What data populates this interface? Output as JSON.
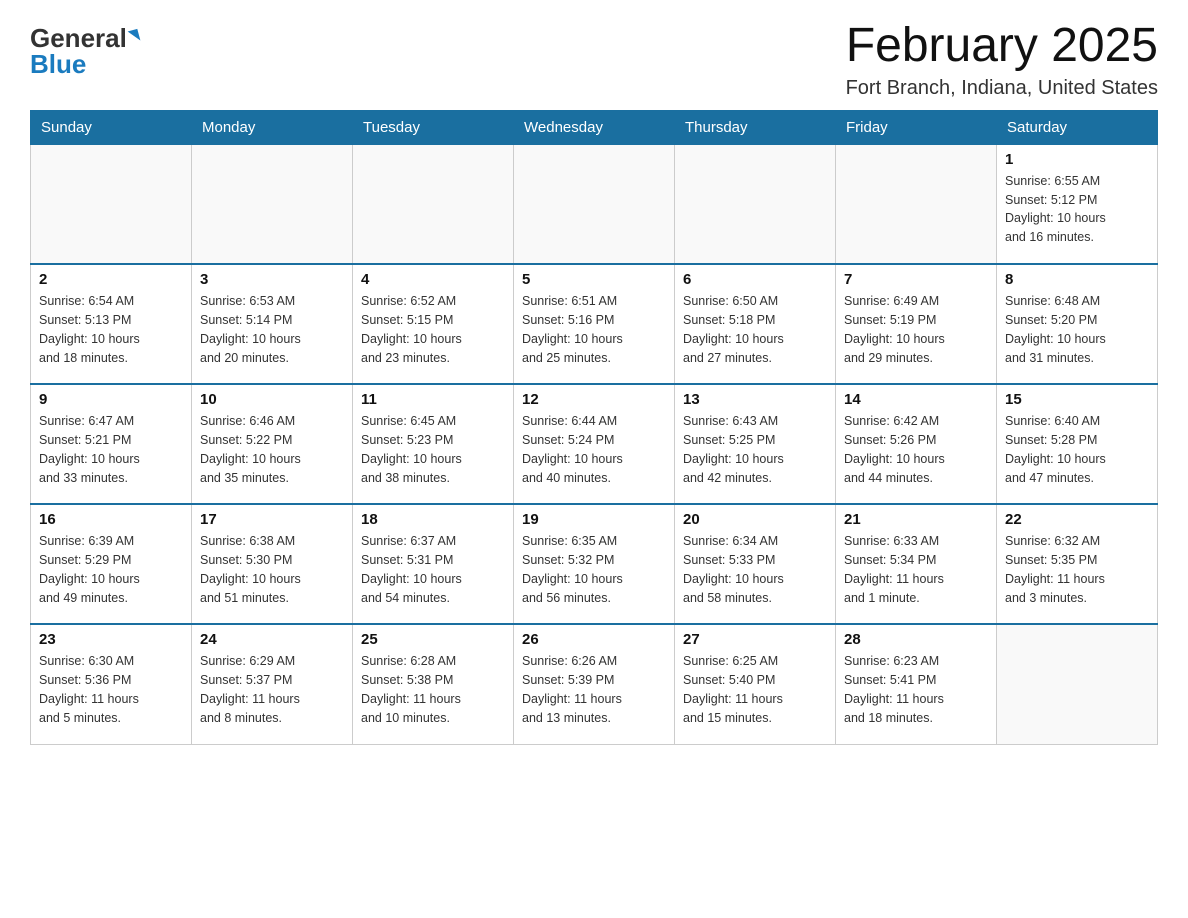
{
  "header": {
    "logo_general": "General",
    "logo_blue": "Blue",
    "title": "February 2025",
    "location": "Fort Branch, Indiana, United States"
  },
  "days_of_week": [
    "Sunday",
    "Monday",
    "Tuesday",
    "Wednesday",
    "Thursday",
    "Friday",
    "Saturday"
  ],
  "weeks": [
    [
      {
        "day": "",
        "info": ""
      },
      {
        "day": "",
        "info": ""
      },
      {
        "day": "",
        "info": ""
      },
      {
        "day": "",
        "info": ""
      },
      {
        "day": "",
        "info": ""
      },
      {
        "day": "",
        "info": ""
      },
      {
        "day": "1",
        "info": "Sunrise: 6:55 AM\nSunset: 5:12 PM\nDaylight: 10 hours\nand 16 minutes."
      }
    ],
    [
      {
        "day": "2",
        "info": "Sunrise: 6:54 AM\nSunset: 5:13 PM\nDaylight: 10 hours\nand 18 minutes."
      },
      {
        "day": "3",
        "info": "Sunrise: 6:53 AM\nSunset: 5:14 PM\nDaylight: 10 hours\nand 20 minutes."
      },
      {
        "day": "4",
        "info": "Sunrise: 6:52 AM\nSunset: 5:15 PM\nDaylight: 10 hours\nand 23 minutes."
      },
      {
        "day": "5",
        "info": "Sunrise: 6:51 AM\nSunset: 5:16 PM\nDaylight: 10 hours\nand 25 minutes."
      },
      {
        "day": "6",
        "info": "Sunrise: 6:50 AM\nSunset: 5:18 PM\nDaylight: 10 hours\nand 27 minutes."
      },
      {
        "day": "7",
        "info": "Sunrise: 6:49 AM\nSunset: 5:19 PM\nDaylight: 10 hours\nand 29 minutes."
      },
      {
        "day": "8",
        "info": "Sunrise: 6:48 AM\nSunset: 5:20 PM\nDaylight: 10 hours\nand 31 minutes."
      }
    ],
    [
      {
        "day": "9",
        "info": "Sunrise: 6:47 AM\nSunset: 5:21 PM\nDaylight: 10 hours\nand 33 minutes."
      },
      {
        "day": "10",
        "info": "Sunrise: 6:46 AM\nSunset: 5:22 PM\nDaylight: 10 hours\nand 35 minutes."
      },
      {
        "day": "11",
        "info": "Sunrise: 6:45 AM\nSunset: 5:23 PM\nDaylight: 10 hours\nand 38 minutes."
      },
      {
        "day": "12",
        "info": "Sunrise: 6:44 AM\nSunset: 5:24 PM\nDaylight: 10 hours\nand 40 minutes."
      },
      {
        "day": "13",
        "info": "Sunrise: 6:43 AM\nSunset: 5:25 PM\nDaylight: 10 hours\nand 42 minutes."
      },
      {
        "day": "14",
        "info": "Sunrise: 6:42 AM\nSunset: 5:26 PM\nDaylight: 10 hours\nand 44 minutes."
      },
      {
        "day": "15",
        "info": "Sunrise: 6:40 AM\nSunset: 5:28 PM\nDaylight: 10 hours\nand 47 minutes."
      }
    ],
    [
      {
        "day": "16",
        "info": "Sunrise: 6:39 AM\nSunset: 5:29 PM\nDaylight: 10 hours\nand 49 minutes."
      },
      {
        "day": "17",
        "info": "Sunrise: 6:38 AM\nSunset: 5:30 PM\nDaylight: 10 hours\nand 51 minutes."
      },
      {
        "day": "18",
        "info": "Sunrise: 6:37 AM\nSunset: 5:31 PM\nDaylight: 10 hours\nand 54 minutes."
      },
      {
        "day": "19",
        "info": "Sunrise: 6:35 AM\nSunset: 5:32 PM\nDaylight: 10 hours\nand 56 minutes."
      },
      {
        "day": "20",
        "info": "Sunrise: 6:34 AM\nSunset: 5:33 PM\nDaylight: 10 hours\nand 58 minutes."
      },
      {
        "day": "21",
        "info": "Sunrise: 6:33 AM\nSunset: 5:34 PM\nDaylight: 11 hours\nand 1 minute."
      },
      {
        "day": "22",
        "info": "Sunrise: 6:32 AM\nSunset: 5:35 PM\nDaylight: 11 hours\nand 3 minutes."
      }
    ],
    [
      {
        "day": "23",
        "info": "Sunrise: 6:30 AM\nSunset: 5:36 PM\nDaylight: 11 hours\nand 5 minutes."
      },
      {
        "day": "24",
        "info": "Sunrise: 6:29 AM\nSunset: 5:37 PM\nDaylight: 11 hours\nand 8 minutes."
      },
      {
        "day": "25",
        "info": "Sunrise: 6:28 AM\nSunset: 5:38 PM\nDaylight: 11 hours\nand 10 minutes."
      },
      {
        "day": "26",
        "info": "Sunrise: 6:26 AM\nSunset: 5:39 PM\nDaylight: 11 hours\nand 13 minutes."
      },
      {
        "day": "27",
        "info": "Sunrise: 6:25 AM\nSunset: 5:40 PM\nDaylight: 11 hours\nand 15 minutes."
      },
      {
        "day": "28",
        "info": "Sunrise: 6:23 AM\nSunset: 5:41 PM\nDaylight: 11 hours\nand 18 minutes."
      },
      {
        "day": "",
        "info": ""
      }
    ]
  ]
}
